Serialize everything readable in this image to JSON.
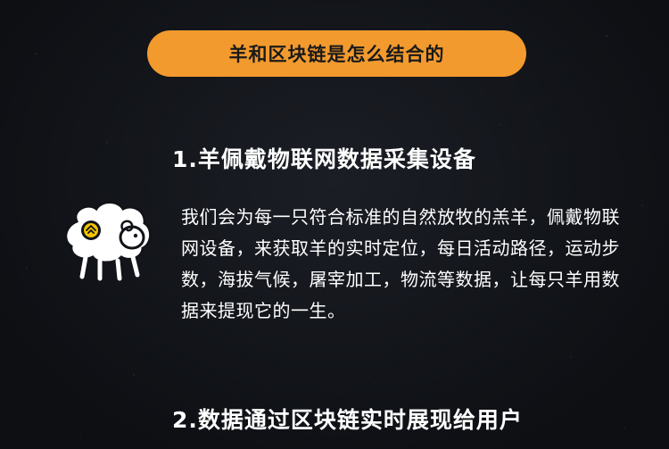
{
  "header": {
    "title": "羊和区块链是怎么结合的"
  },
  "sections": [
    {
      "heading": "1.羊佩戴物联网数据采集设备",
      "body": "我们会为每一只符合标准的自然放牧的羔羊，佩戴物联网设备，来获取羊的实时定位，每日活动路径，运动步数，海拔气候，屠宰加工，物流等数据，让每只羊用数据来提现它的一生。",
      "icon": "sheep-icon"
    },
    {
      "heading": "2.数据通过区块链实时展现给用户"
    }
  ],
  "colors": {
    "accent": "#f29a2e",
    "background": "#111318",
    "text": "#ffffff",
    "icon_badge": "#f5c400"
  }
}
